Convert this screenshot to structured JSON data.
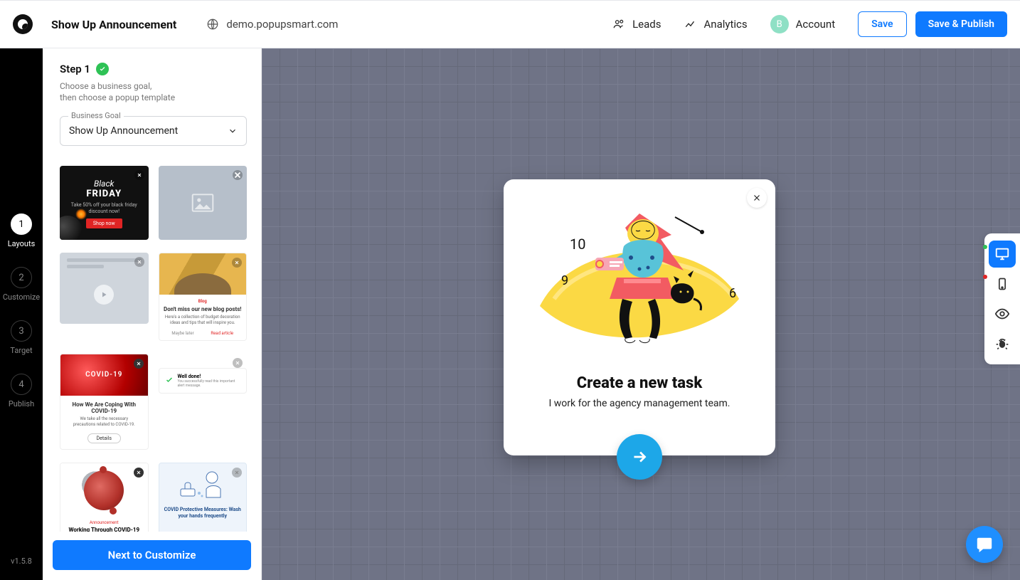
{
  "header": {
    "title": "Show Up Announcement",
    "domain": "demo.popupsmart.com",
    "links": {
      "leads": "Leads",
      "analytics": "Analytics",
      "account": "Account"
    },
    "avatar_initial": "B",
    "save": "Save",
    "save_publish": "Save & Publish"
  },
  "rail": {
    "items": [
      {
        "num": "1",
        "label": "Layouts"
      },
      {
        "num": "2",
        "label": "Customize"
      },
      {
        "num": "3",
        "label": "Target"
      },
      {
        "num": "4",
        "label": "Publish"
      }
    ],
    "version": "v1.5.8"
  },
  "sidebar": {
    "step_title": "Step 1",
    "step_desc_1": "Choose a business goal,",
    "step_desc_2": "then choose a popup template",
    "select_legend": "Business Goal",
    "select_value": "Show Up Announcement",
    "next": "Next to Customize",
    "templates": {
      "bf_line1": "Black",
      "bf_line2": "FRIDAY",
      "bf_sub": "Take 50% off your black friday discount now!",
      "bf_cta": "Shop now",
      "blog_tag": "Blog",
      "blog_title": "Don't miss our new blog posts!",
      "blog_body": "Here's a collection of budget decoration ideas and tips that will inspire you.",
      "blog_later": "Maybe later",
      "blog_read": "Read article",
      "covid_hero": "COVID-19",
      "covid_title": "How We Are Coping With COVID-19",
      "covid_body": "We take all the necessary precautions related to COVID-19.",
      "covid_details": "Details",
      "toast_title": "Well done!",
      "toast_body": "You successfully read this important alert message.",
      "virus_label": "Announcement",
      "virus_title": "Working Through COVID-19",
      "wash_title": "COVID Protective Measures: Wash your hands frequently"
    }
  },
  "popup": {
    "title": "Create a new task",
    "subtitle": "I work for the agency management team."
  }
}
